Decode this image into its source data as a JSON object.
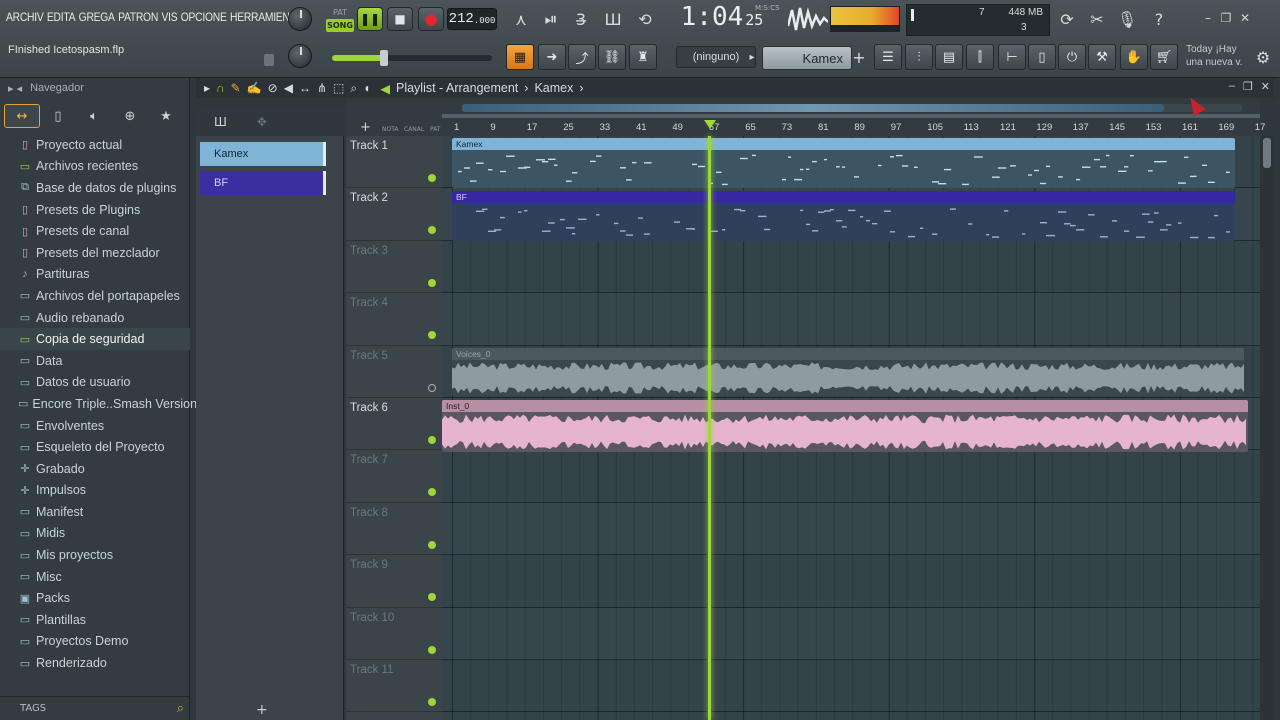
{
  "menu": [
    "ARCHIV",
    "EDITA",
    "GREGA",
    "PATRON",
    "VIS",
    "OPCIONE",
    "HERRAMIENTA"
  ],
  "hint": "FInished Icetospasm.flp",
  "transport": {
    "pat_label": "PAT",
    "song_label": "SONG",
    "tempo": "212",
    "tempo_frac": ".000",
    "time_main": "1:04",
    "time_sub": "25",
    "time_format": "M:S:CS"
  },
  "cpu": {
    "value1": "7",
    "memory": "448 MB",
    "polyphony": "3"
  },
  "toolbar2": {
    "channel": "(ninguno)",
    "pattern": "Kamex"
  },
  "news": {
    "line1": "Today  ¡Hay",
    "line2": "una nueva v."
  },
  "browser": {
    "title": "Navegador",
    "items": [
      {
        "label": "Proyecto actual",
        "icon": "project-icon",
        "kind": "pink"
      },
      {
        "label": "Archivos recientes",
        "icon": "recent-icon",
        "kind": "green"
      },
      {
        "label": "Base de datos de plugins",
        "icon": "plugin-db-icon",
        "kind": "blue"
      },
      {
        "label": "Presets de Plugins",
        "icon": "preset-icon",
        "kind": "pink"
      },
      {
        "label": "Presets de canal",
        "icon": "preset-icon",
        "kind": "pink"
      },
      {
        "label": "Presets del mezclador",
        "icon": "preset-icon",
        "kind": "pink"
      },
      {
        "label": "Partituras",
        "icon": "note-icon",
        "kind": "pink"
      },
      {
        "label": "Archivos del portapapeles",
        "icon": "folder-icon",
        "kind": "blue"
      },
      {
        "label": "Audio rebanado",
        "icon": "folder-icon",
        "kind": "blue"
      },
      {
        "label": "Copia de seguridad",
        "icon": "backup-icon",
        "kind": "green"
      },
      {
        "label": "Data",
        "icon": "folder-icon",
        "kind": "blue"
      },
      {
        "label": "Datos de usuario",
        "icon": "folder-icon",
        "kind": "blue"
      },
      {
        "label": "Encore Triple..Smash Version",
        "icon": "folder-icon",
        "kind": "blue"
      },
      {
        "label": "Envolventes",
        "icon": "folder-icon",
        "kind": "blue"
      },
      {
        "label": "Esqueleto del Proyecto",
        "icon": "folder-icon",
        "kind": "blue"
      },
      {
        "label": "Grabado",
        "icon": "record-icon",
        "kind": "blue"
      },
      {
        "label": "Impulsos",
        "icon": "impulse-icon",
        "kind": "blue"
      },
      {
        "label": "Manifest",
        "icon": "folder-icon",
        "kind": "blue"
      },
      {
        "label": "Midis",
        "icon": "folder-icon",
        "kind": "blue"
      },
      {
        "label": "Mis proyectos",
        "icon": "folder-icon",
        "kind": "blue"
      },
      {
        "label": "Misc",
        "icon": "folder-icon",
        "kind": "blue"
      },
      {
        "label": "Packs",
        "icon": "packs-icon",
        "kind": "blue"
      },
      {
        "label": "Plantillas",
        "icon": "folder-icon",
        "kind": "blue"
      },
      {
        "label": "Proyectos Demo",
        "icon": "folder-icon",
        "kind": "blue"
      },
      {
        "label": "Renderizado",
        "icon": "folder-icon",
        "kind": "blue"
      }
    ],
    "tags_label": "TAGS"
  },
  "picker": {
    "clips": [
      "Kamex",
      "BF"
    ]
  },
  "playlist": {
    "title": "Playlist - Arrangement",
    "pattern": "Kamex",
    "ruler_labels": [
      "1",
      "9",
      "17",
      "25",
      "33",
      "41",
      "49",
      "57",
      "65",
      "73",
      "81",
      "89",
      "97",
      "105",
      "113",
      "121",
      "129",
      "137",
      "145",
      "153",
      "161",
      "169",
      "17"
    ],
    "header_small": [
      "NOTA",
      "CANAL",
      "PAT"
    ],
    "tracks": [
      "Track 1",
      "Track 2",
      "Track 3",
      "Track 4",
      "Track 5",
      "Track 6",
      "Track 7",
      "Track 8",
      "Track 9",
      "Track 10",
      "Track 11"
    ],
    "clips": {
      "kamex": "Kamex",
      "bf": "BF",
      "voices": "Voices_0",
      "inst": "Inst_0"
    }
  }
}
